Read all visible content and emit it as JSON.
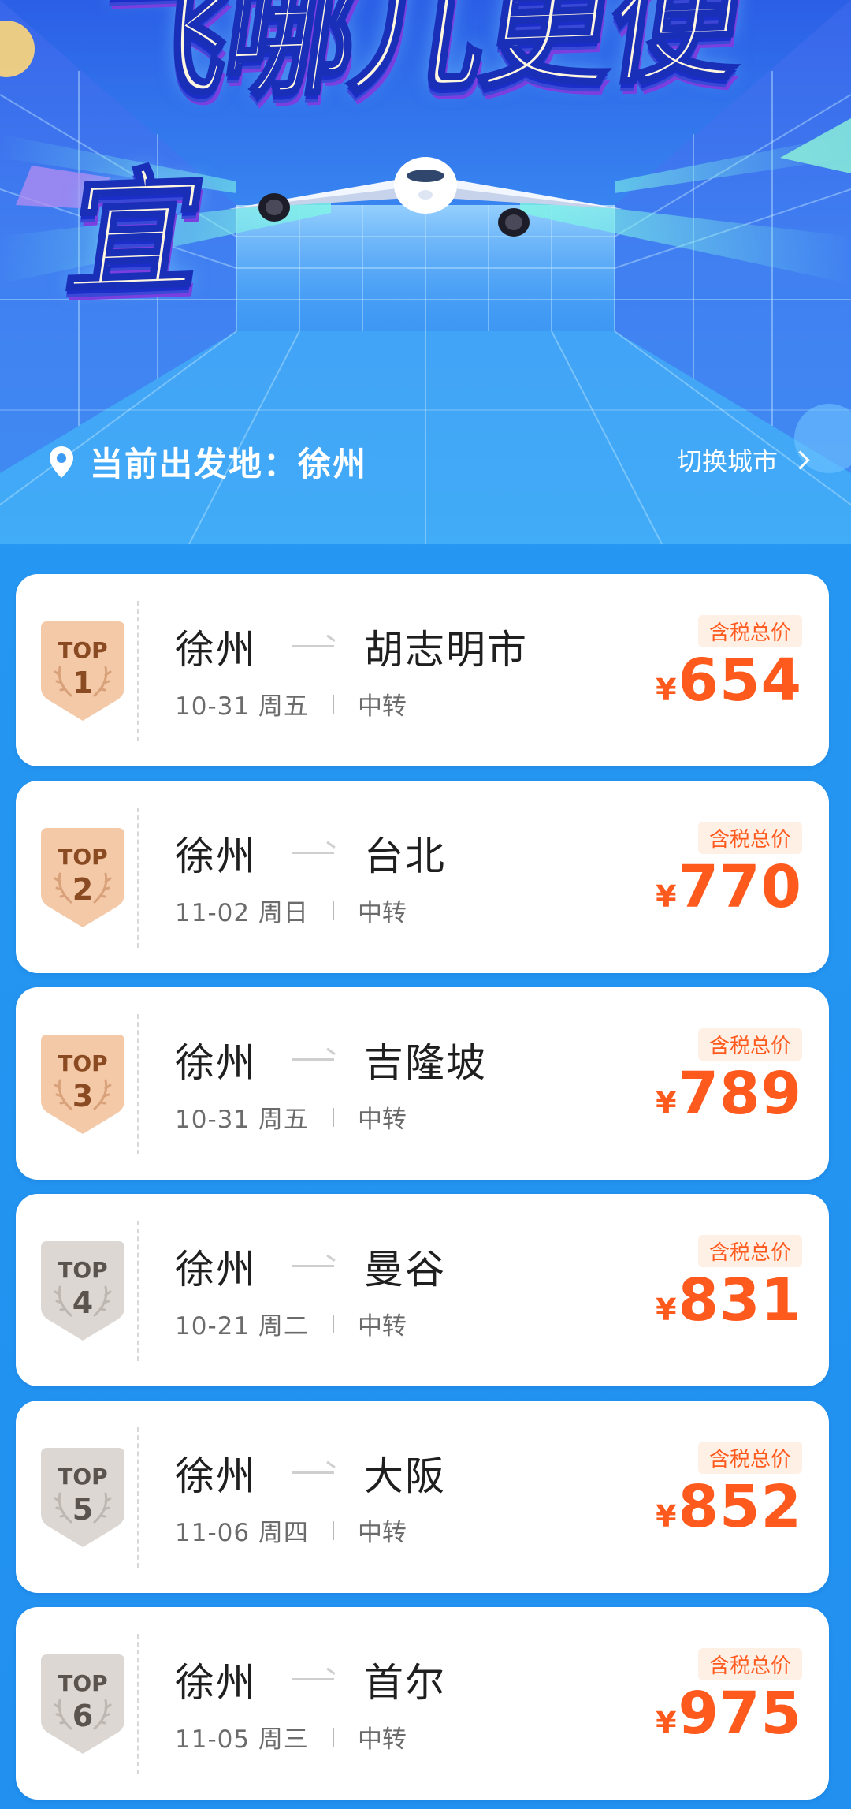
{
  "hero": {
    "title": "飞哪儿更便宜",
    "location_label": "当前出发地：徐州",
    "switch_city_label": "切换城市"
  },
  "colors": {
    "price": "#ff5a1e",
    "price_tag_bg": "#fff0e6",
    "badge_bronze": "#f3c9a8",
    "badge_silver": "#dcd7d3"
  },
  "icons": {
    "location": "map-pin-icon",
    "switch": "chevron-right-icon",
    "arrow": "route-arrow-icon"
  },
  "flights": [
    {
      "rank_label": "TOP",
      "rank": "1",
      "from": "徐州",
      "to": "胡志明市",
      "date": "10-31 周五",
      "transfer": "中转",
      "price_label": "含税总价",
      "currency": "¥",
      "price": "654",
      "tier": "bronze"
    },
    {
      "rank_label": "TOP",
      "rank": "2",
      "from": "徐州",
      "to": "台北",
      "date": "11-02 周日",
      "transfer": "中转",
      "price_label": "含税总价",
      "currency": "¥",
      "price": "770",
      "tier": "bronze"
    },
    {
      "rank_label": "TOP",
      "rank": "3",
      "from": "徐州",
      "to": "吉隆坡",
      "date": "10-31 周五",
      "transfer": "中转",
      "price_label": "含税总价",
      "currency": "¥",
      "price": "789",
      "tier": "bronze"
    },
    {
      "rank_label": "TOP",
      "rank": "4",
      "from": "徐州",
      "to": "曼谷",
      "date": "10-21 周二",
      "transfer": "中转",
      "price_label": "含税总价",
      "currency": "¥",
      "price": "831",
      "tier": "silver"
    },
    {
      "rank_label": "TOP",
      "rank": "5",
      "from": "徐州",
      "to": "大阪",
      "date": "11-06 周四",
      "transfer": "中转",
      "price_label": "含税总价",
      "currency": "¥",
      "price": "852",
      "tier": "silver"
    },
    {
      "rank_label": "TOP",
      "rank": "6",
      "from": "徐州",
      "to": "首尔",
      "date": "11-05 周三",
      "transfer": "中转",
      "price_label": "含税总价",
      "currency": "¥",
      "price": "975",
      "tier": "silver"
    }
  ]
}
